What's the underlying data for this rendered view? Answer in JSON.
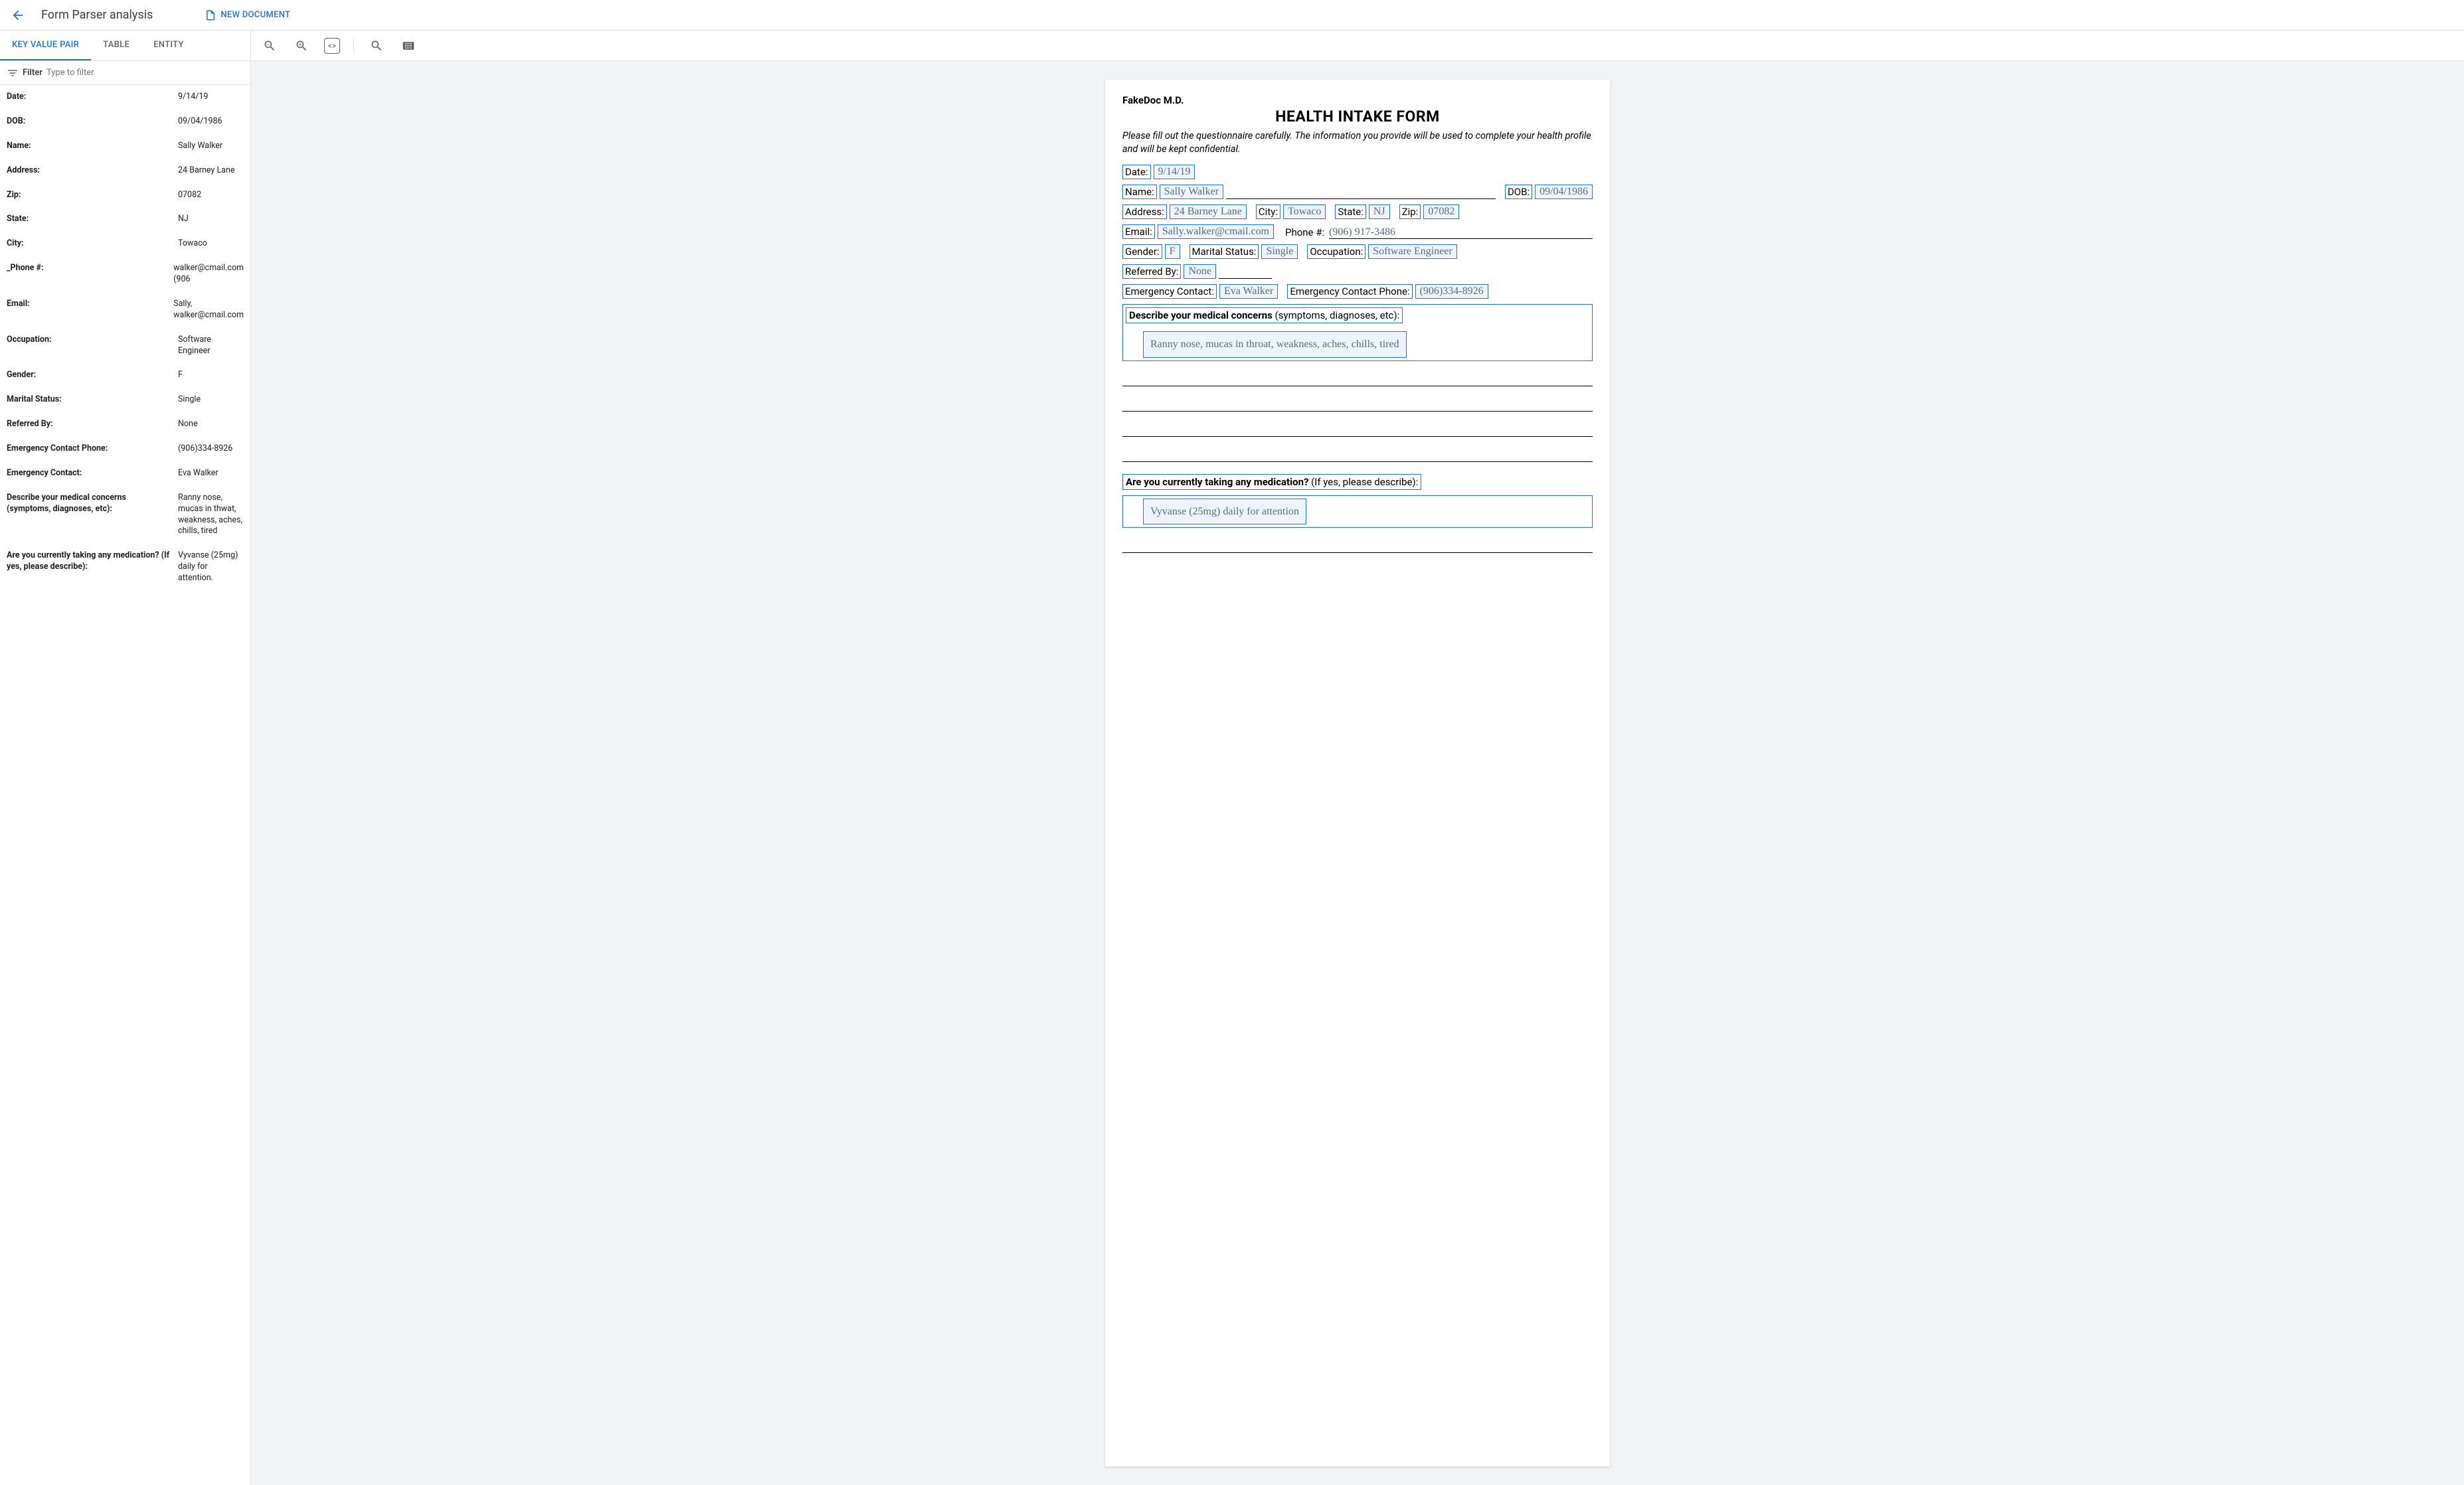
{
  "header": {
    "title": "Form Parser analysis",
    "new_document_label": "NEW DOCUMENT"
  },
  "tabs": {
    "kvp": "KEY VALUE PAIR",
    "table": "TABLE",
    "entity": "ENTITY"
  },
  "filter": {
    "label": "Filter",
    "placeholder": "Type to filter"
  },
  "kv_pairs": [
    {
      "k": "Date:",
      "v": "9/14/19"
    },
    {
      "k": "DOB:",
      "v": "09/04/1986"
    },
    {
      "k": "Name:",
      "v": "Sally Walker"
    },
    {
      "k": "Address:",
      "v": "24 Barney Lane"
    },
    {
      "k": "Zip:",
      "v": "07082"
    },
    {
      "k": "State:",
      "v": "NJ"
    },
    {
      "k": "City:",
      "v": "Towaco"
    },
    {
      "k": "_Phone #:",
      "v": "walker@cmail.com (906"
    },
    {
      "k": "Email:",
      "v": "Sally, walker@cmail.com"
    },
    {
      "k": "Occupation:",
      "v": "Software Engineer"
    },
    {
      "k": "Gender:",
      "v": "F"
    },
    {
      "k": "Marital Status:",
      "v": "Single"
    },
    {
      "k": "Referred By:",
      "v": "None"
    },
    {
      "k": "Emergency Contact Phone:",
      "v": "(906)334-8926"
    },
    {
      "k": "Emergency Contact:",
      "v": "Eva Walker"
    },
    {
      "k": "Describe your medical concerns (symptoms, diagnoses, etc):",
      "v": "Ranny nose, mucas in thwat, weakness, aches, chills, tired"
    },
    {
      "k": "Are you currently taking any medication? (If yes, please describe):",
      "v": "Vyvanse (25mg) daily for attention."
    }
  ],
  "doc": {
    "provider": "FakeDoc M.D.",
    "title": "HEALTH INTAKE FORM",
    "subtitle": "Please fill out the questionnaire carefully. The information you provide will be used to complete your health profile and will be kept confidential.",
    "fields": {
      "date_l": "Date:",
      "date_v": "9/14/19",
      "name_l": "Name:",
      "name_v": "Sally Walker",
      "dob_l": "DOB:",
      "dob_v": "09/04/1986",
      "addr_l": "Address:",
      "addr_v": "24 Barney Lane",
      "city_l": "City:",
      "city_v": "Towaco",
      "state_l": "State:",
      "state_v": "NJ",
      "zip_l": "Zip:",
      "zip_v": "07082",
      "email_l": "Email:",
      "email_v": "Sally.walker@cmail.com",
      "phone_l": "Phone #:",
      "phone_v": "(906) 917-3486",
      "gender_l": "Gender:",
      "gender_v": "F",
      "mar_l": "Marital Status:",
      "mar_v": "Single",
      "occ_l": "Occupation:",
      "occ_v": "Software Engineer",
      "ref_l": "Referred By:",
      "ref_v": "None",
      "ec_l": "Emergency Contact:",
      "ec_v": "Eva Walker",
      "ecp_l": "Emergency Contact Phone:",
      "ecp_v": "(906)334-8926"
    },
    "concerns_label_strong": "Describe your medical concerns",
    "concerns_label_rest": " (symptoms, diagnoses, etc):",
    "concerns_value": "Ranny nose, mucas in throat, weakness, aches, chills, tired",
    "meds_label_strong": "Are you currently taking any medication?",
    "meds_label_rest": " (If yes, please describe):",
    "meds_value": "Vyvanse (25mg) daily for attention"
  },
  "colors": {
    "accent": "#1a73e8"
  }
}
